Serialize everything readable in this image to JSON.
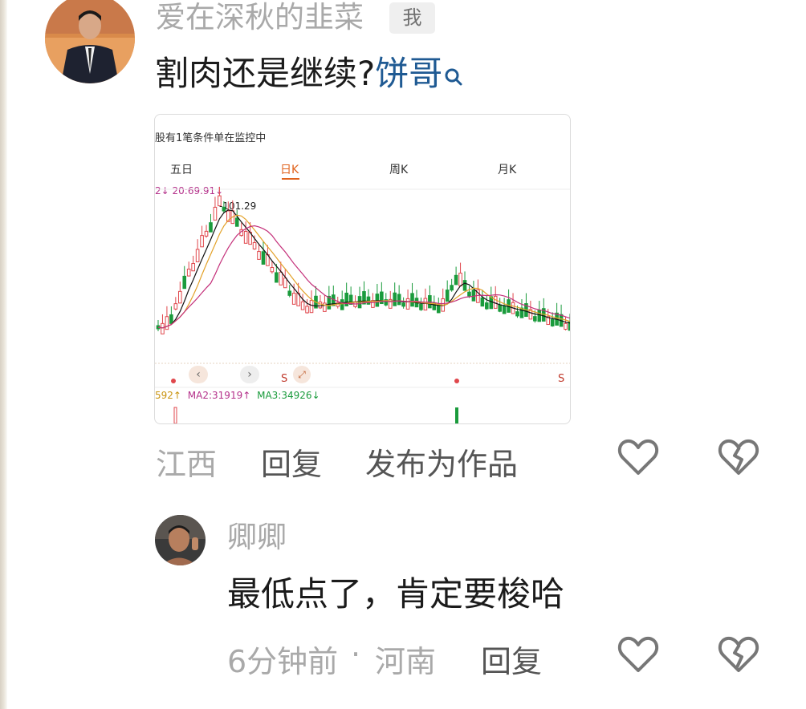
{
  "comment1": {
    "username": "爱在深秋的韭菜",
    "me_badge": "我",
    "text": "割肉还是继续?",
    "mention": "饼哥",
    "icon": "search-icon",
    "location": "江西",
    "reply_label": "回复",
    "publish_label": "发布为作品",
    "like_icon": "heart-outline-icon",
    "dislike_icon": "broken-heart-icon",
    "screenshot": {
      "header": "股有1笔条件单在监控中",
      "header_highlight": "1",
      "tabs": [
        "五日",
        "日K",
        "周K",
        "月K"
      ],
      "active_tab": "日K",
      "ma_top": "2↓ 20:69.91↓",
      "peak_label": "-101.29",
      "markers": [
        "S",
        "S"
      ],
      "vol_ma1": "592↑",
      "vol_ma2": "MA2:31919↑",
      "vol_ma3": "MA3:34926↓",
      "colors": {
        "up": "#e0474c",
        "down": "#1a9b3c",
        "ma5": "#111111",
        "ma10": "#e3a22a",
        "ma20": "#c4307a",
        "active": "#e0621c"
      }
    }
  },
  "comment2": {
    "username": "卿卿",
    "text": "最低点了，肯定要梭哈",
    "time": "6分钟前",
    "separator": "·",
    "location": "河南",
    "reply_label": "回复",
    "like_icon": "heart-outline-icon",
    "dislike_icon": "broken-heart-icon"
  }
}
